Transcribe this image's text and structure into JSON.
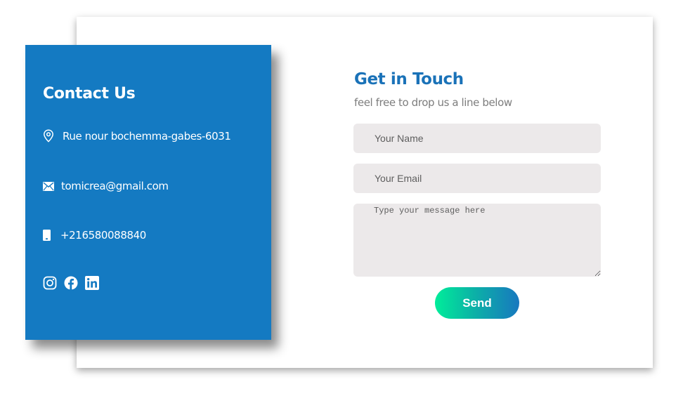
{
  "contact": {
    "title": "Contact Us",
    "address": "Rue nour bochemma-gabes-6031",
    "email": "tomicrea@gmail.com",
    "phone": "+216580088840",
    "icons": {
      "address": "location-pin-icon",
      "email": "envelope-icon",
      "phone": "mobile-phone-icon",
      "socials": [
        "instagram-icon",
        "facebook-icon",
        "linkedin-icon"
      ]
    }
  },
  "form": {
    "heading": "Get in Touch",
    "subtitle": "feel free to drop us a line below",
    "name_placeholder": "Your Name",
    "email_placeholder": "Your Email",
    "message_placeholder": "Type your message here",
    "send_label": "Send"
  },
  "colors": {
    "panel": "#147ac2",
    "heading": "#1a72b8",
    "field_bg": "#ece9ea",
    "button_gradient_start": "#00ed9a",
    "button_gradient_end": "#1878bf"
  }
}
